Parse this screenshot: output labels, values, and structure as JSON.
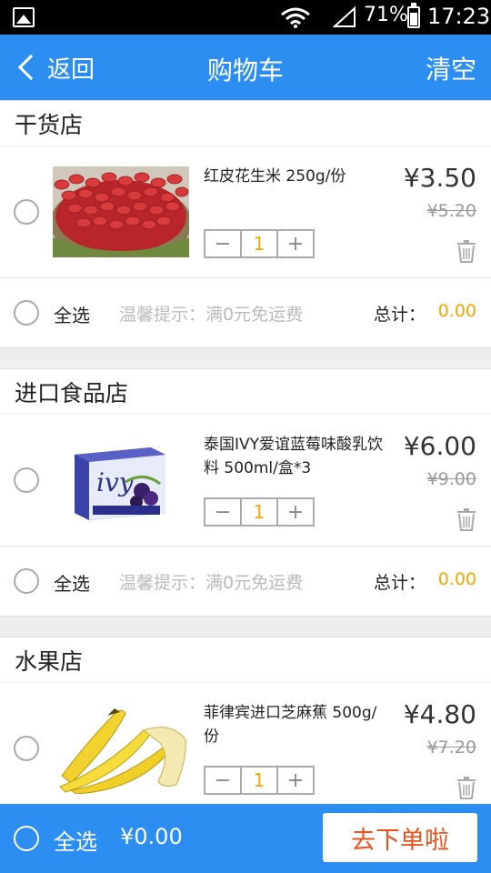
{
  "status_bar": {
    "battery": "71%",
    "time": "17:23"
  },
  "header": {
    "back_label": "返回",
    "title": "购物车",
    "clear_label": "清空"
  },
  "shops": [
    {
      "name": "干货店",
      "item": {
        "name": "红皮花生米 250g/份",
        "qty": "1",
        "price": "¥3.50",
        "old_price": "¥5.20",
        "image": "red-peanuts"
      },
      "select_all": "全选",
      "tip": "温馨提示：满0元免运费",
      "total_label": "总计：",
      "total_value": "0.00"
    },
    {
      "name": "进口食品店",
      "item": {
        "name": "泰国IVY爱谊蓝莓味酸乳饮料 500ml/盒*3",
        "qty": "1",
        "price": "¥6.00",
        "old_price": "¥9.00",
        "image": "ivy-blueberry-drink"
      },
      "select_all": "全选",
      "tip": "温馨提示：满0元免运费",
      "total_label": "总计：",
      "total_value": "0.00"
    },
    {
      "name": "水果店",
      "item": {
        "name": "菲律宾进口芝麻蕉 500g/份",
        "qty": "1",
        "price": "¥4.80",
        "old_price": "¥7.20",
        "image": "bananas"
      }
    }
  ],
  "stepper": {
    "minus": "−",
    "plus": "+"
  },
  "bottom_bar": {
    "select_all": "全选",
    "total": "¥0.00",
    "checkout": "去下单啦"
  },
  "colors": {
    "primary": "#2d8ef1",
    "accent": "#f5a500",
    "checkout_text": "#e8541e"
  },
  "image_text": {
    "juice_brand": "ivy"
  }
}
